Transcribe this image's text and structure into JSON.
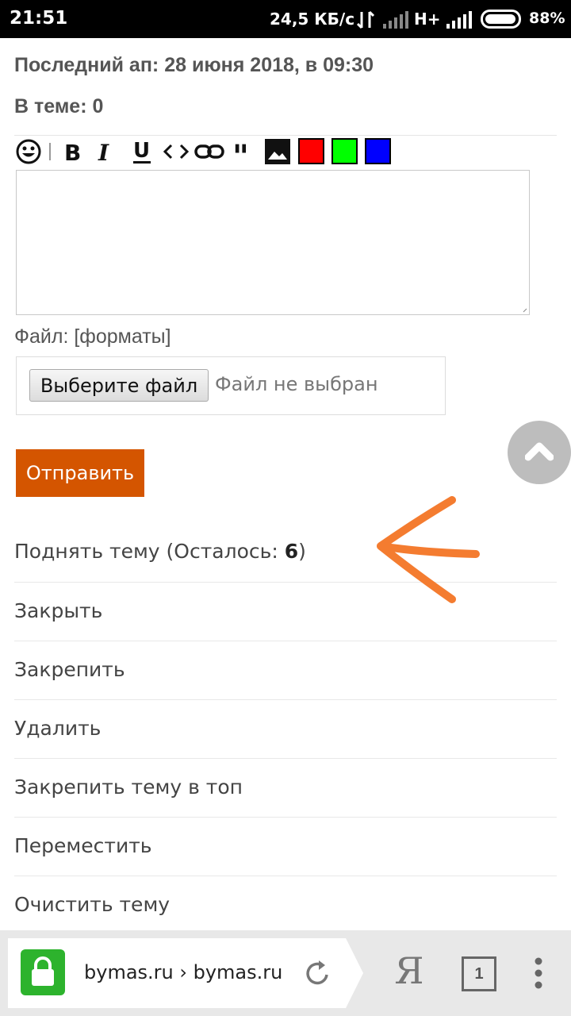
{
  "status_bar": {
    "time": "21:51",
    "net_speed": "24,5 КБ/с",
    "network_type": "H+",
    "battery": "88%"
  },
  "topic": {
    "last_update": "Последний ап: 28 июня 2018, в 09:30",
    "in_topic": "В теме: 0"
  },
  "editor_toolbar": {
    "icons": [
      "smile-icon",
      "bold-icon",
      "italic-icon",
      "underline-icon",
      "code-icon",
      "link-icon",
      "quote-icon",
      "image-icon"
    ],
    "colors": [
      "#ff0000",
      "#00ff00",
      "#0000ff"
    ]
  },
  "file": {
    "label": "Файл: [форматы]",
    "choose_button": "Выберите файл",
    "no_file": "Файл не выбран"
  },
  "submit_label": "Отправить",
  "menu": {
    "raise_prefix": "Поднять тему (Осталось: ",
    "raise_count": "6",
    "raise_suffix": ")",
    "items": [
      "Закрыть",
      "Закрепить",
      "Удалить",
      "Закрепить тему в топ",
      "Переместить",
      "Очистить тему"
    ]
  },
  "browser": {
    "url": "bymas.ru › bymas.ru",
    "tabs_count": "1",
    "yandex_label": "Я"
  },
  "annotation_color": "#f47c30"
}
